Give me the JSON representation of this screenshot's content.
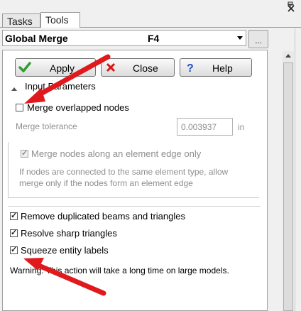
{
  "tabs": [
    {
      "label": "Tasks",
      "active": false
    },
    {
      "label": "Tools",
      "active": true
    }
  ],
  "window": {
    "pin_icon": "pin-icon",
    "close_icon": "close-icon"
  },
  "tool_selector": {
    "value": "Global Merge",
    "shortcut": "F4",
    "more_label": "..."
  },
  "buttons": {
    "apply": {
      "label": "Apply",
      "icon": "green-check-icon"
    },
    "close": {
      "label": "Close",
      "icon": "red-x-icon"
    },
    "help": {
      "label": "Help",
      "icon": "blue-question-icon"
    }
  },
  "input_parameters": {
    "header": "Input Parameters",
    "merge_overlapped": {
      "label": "Merge overlapped nodes",
      "checked": false
    },
    "merge_tolerance": {
      "label": "Merge tolerance",
      "value": "0.003937",
      "unit": "in"
    },
    "merge_along_edge": {
      "label": "Merge nodes along an element edge only",
      "checked": true,
      "enabled": false
    },
    "edge_hint": {
      "line1": "If nodes are connected to the same element type, allow",
      "line2": "merge only if the nodes form an element edge"
    }
  },
  "options": {
    "remove_duplicated": {
      "label": "Remove duplicated beams and triangles",
      "checked": true
    },
    "resolve_sharp": {
      "label": "Resolve sharp triangles",
      "checked": true
    },
    "squeeze_labels": {
      "label": "Squeeze entity labels",
      "checked": true
    }
  },
  "warning": "Warning: This action will take a long time on large models.",
  "colors": {
    "annotation_arrow": "#e0191d",
    "accent_check": "#2e9e2e",
    "help_blue": "#1f4fc4"
  }
}
